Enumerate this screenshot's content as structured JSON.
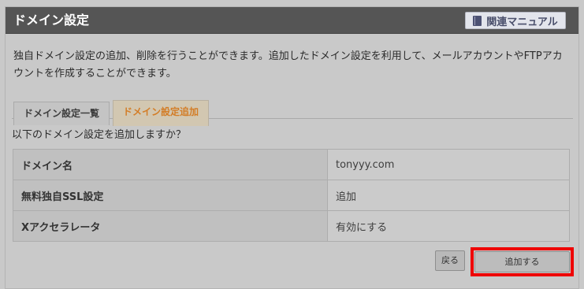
{
  "header": {
    "title": "ドメイン設定",
    "manual_label": "関連マニュアル",
    "manual_icon": "book-icon"
  },
  "description": "独自ドメイン設定の追加、削除を行うことができます。追加したドメイン設定を利用して、メールアカウントやFTPアカウントを作成することができます。",
  "tabs": [
    {
      "label": "ドメイン設定一覧",
      "active": false
    },
    {
      "label": "ドメイン設定追加",
      "active": true
    }
  ],
  "question": "以下のドメイン設定を追加しますか？",
  "table": {
    "rows": [
      {
        "key": "ドメイン名",
        "value": "tonyyy.com"
      },
      {
        "key": "無料独自SSL設定",
        "value": "追加"
      },
      {
        "key": "Xアクセラレータ",
        "value": "有効にする"
      }
    ]
  },
  "buttons": {
    "back_label": "戻る",
    "add_label": "追加する"
  },
  "colors": {
    "header_bg": "#555555",
    "active_tab_text": "#d37d27",
    "highlight_border": "#ee0000"
  }
}
